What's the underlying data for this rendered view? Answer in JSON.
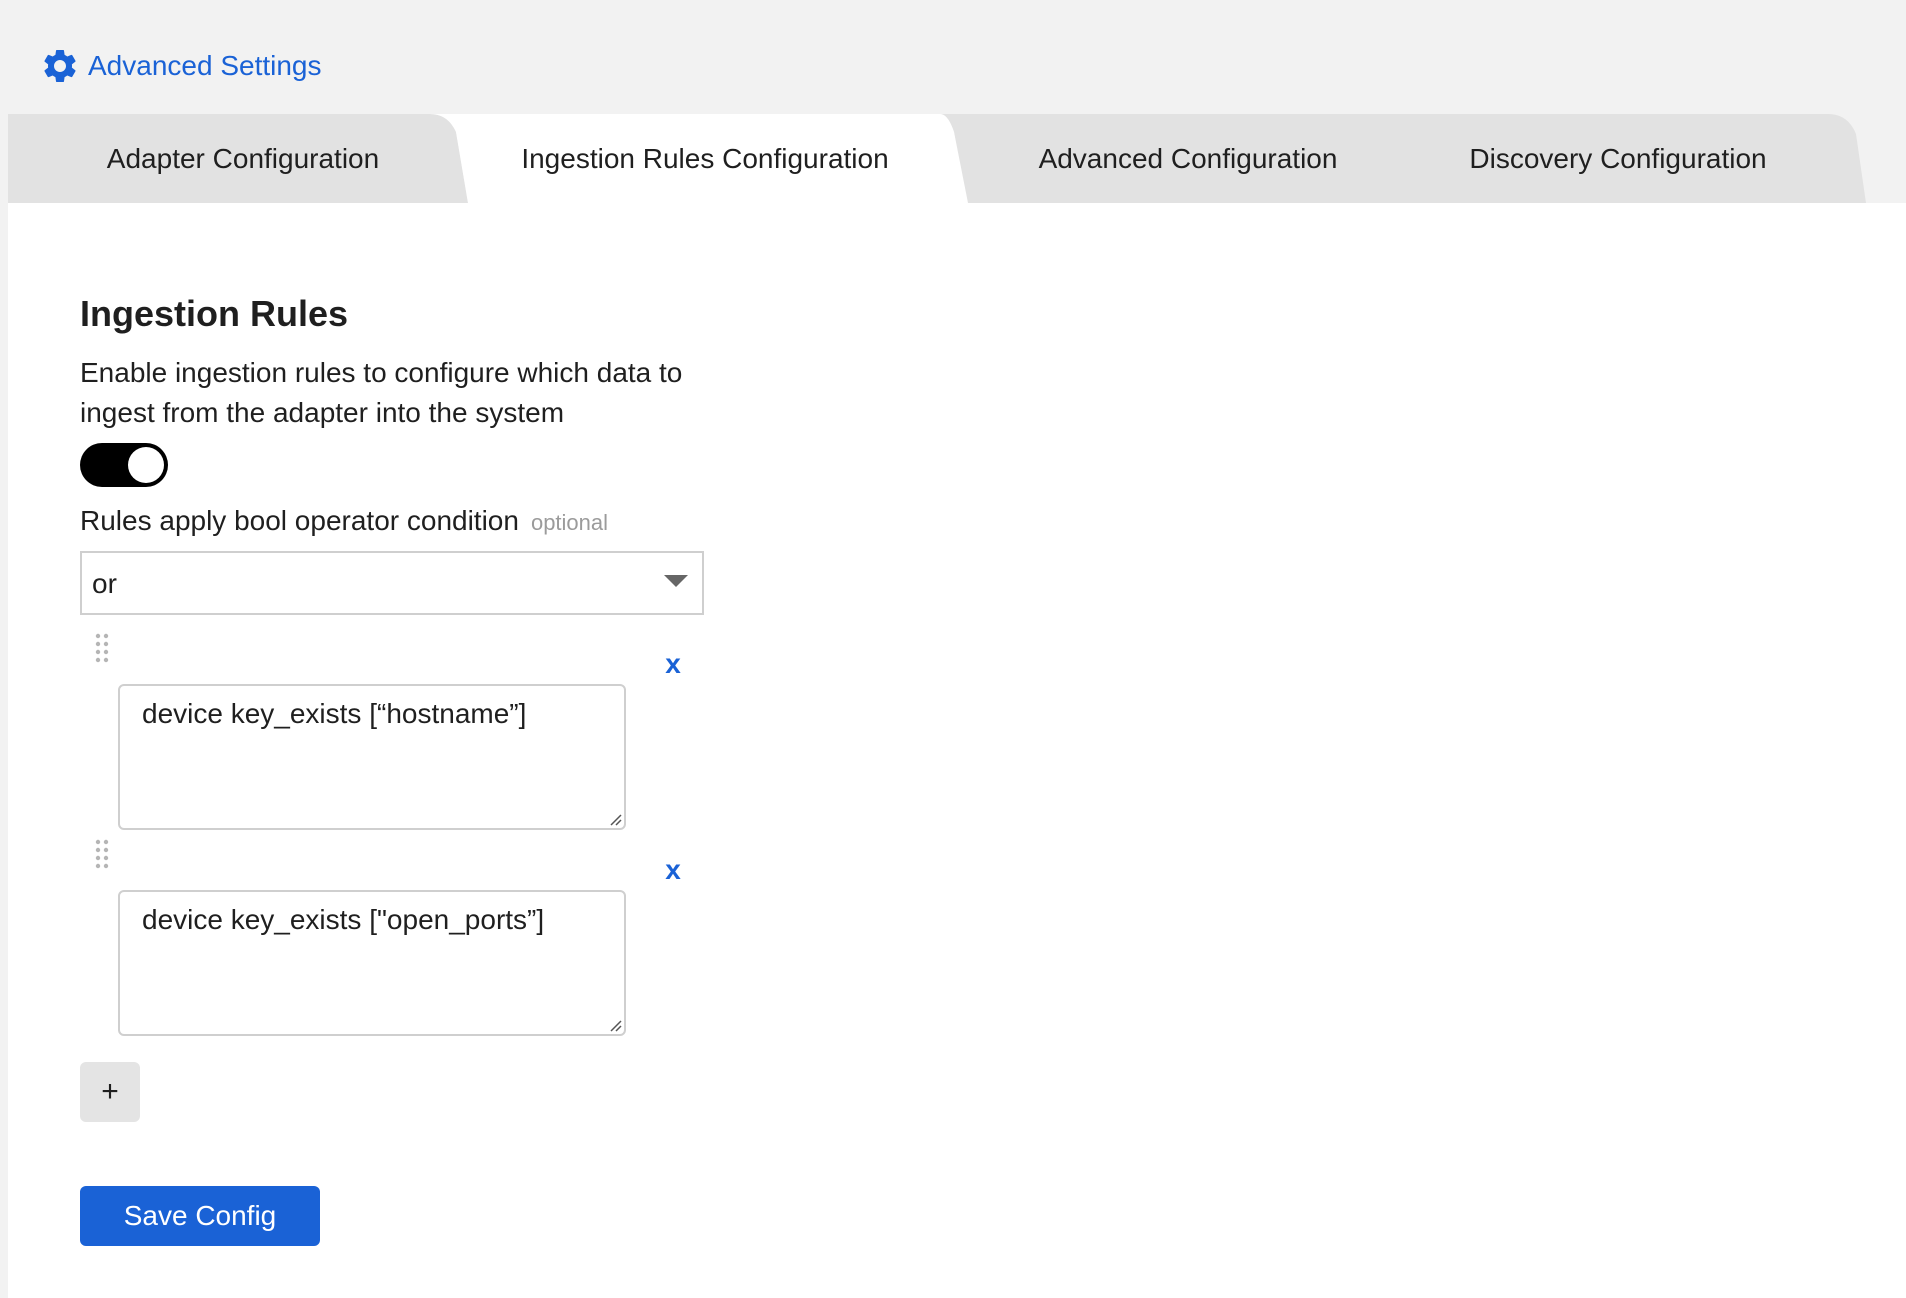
{
  "header": {
    "title": "Advanced Settings",
    "icon": "gear-icon"
  },
  "tabs": [
    {
      "label": "Adapter Configuration",
      "active": false
    },
    {
      "label": "Ingestion Rules Configuration",
      "active": true
    },
    {
      "label": "Advanced Configuration",
      "active": false
    },
    {
      "label": "Discovery Configuration",
      "active": false
    }
  ],
  "section": {
    "title": "Ingestion Rules",
    "description": "Enable ingestion rules to configure which data to ingest from the adapter into the system",
    "toggle_enabled": true
  },
  "condition": {
    "label": "Rules apply bool operator condition",
    "optional": "optional",
    "value": "or"
  },
  "rules": [
    {
      "value": "device key_exists [“hostname”]",
      "remove": "x"
    },
    {
      "value": "device key_exists [\"open_ports”]",
      "remove": "x"
    }
  ],
  "add_label": "+",
  "save_label": "Save Config",
  "colors": {
    "accent": "#1a62d6",
    "tab_inactive": "#e2e2e2",
    "page_bg": "#f2f2f2"
  }
}
